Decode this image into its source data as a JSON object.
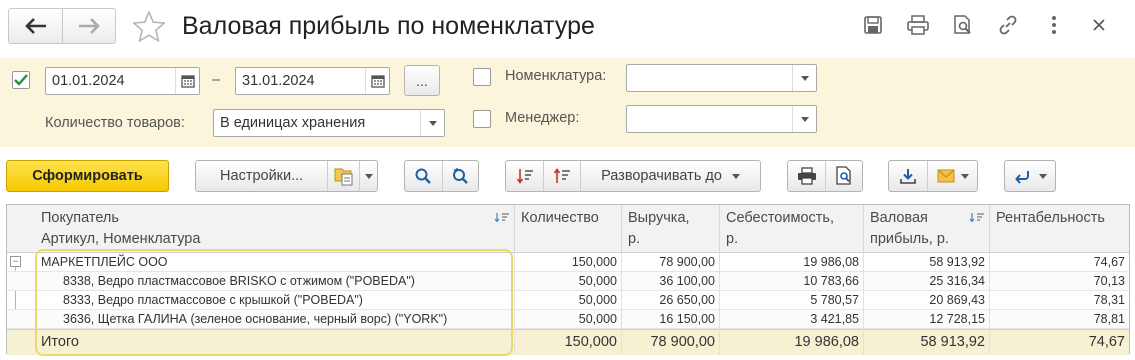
{
  "window": {
    "title": "Валовая прибыль по номенклатуре"
  },
  "params": {
    "period_enabled": true,
    "date_from": "01.01.2024",
    "date_separator": "–",
    "date_to": "31.01.2024",
    "period_button": "...",
    "quantity_label": "Количество товаров:",
    "quantity_value": "В единицах хранения",
    "nomenclature_label": "Номенклатура:",
    "nomenclature_value": "",
    "manager_label": "Менеджер:",
    "manager_value": ""
  },
  "toolbar": {
    "generate": "Сформировать",
    "settings": "Настройки...",
    "expand_to": "Разворачивать до"
  },
  "table": {
    "headers": {
      "buyer": "Покупатель",
      "article": "Артикул, Номенклатура",
      "quantity": "Количество",
      "revenue_1": "Выручка,",
      "revenue_2": "р.",
      "cost_1": "Себестоимость,",
      "cost_2": "р.",
      "profit_1": "Валовая",
      "profit_2": "прибыль, р.",
      "profitability": "Рентабельность"
    },
    "rows": [
      {
        "name": "МАРКЕТПЛЕЙС ООО",
        "quantity": "150,000",
        "revenue": "78 900,00",
        "cost": "19 986,08",
        "profit": "58 913,92",
        "profitability": "74,67"
      },
      {
        "name": "8338, Ведро пластмассовое BRISKO с отжимом (\"POBEDA\")",
        "quantity": "50,000",
        "revenue": "36 100,00",
        "cost": "10 783,66",
        "profit": "25 316,34",
        "profitability": "70,13"
      },
      {
        "name": "8333, Ведро пластмассовое с крышкой (\"POBEDA\")",
        "quantity": "50,000",
        "revenue": "26 650,00",
        "cost": "5 780,57",
        "profit": "20 869,43",
        "profitability": "78,31"
      },
      {
        "name": "3636, Щетка ГАЛИНА (зеленое основание, черный ворс) (\"YORK\")",
        "quantity": "50,000",
        "revenue": "16 150,00",
        "cost": "3 421,85",
        "profit": "12 728,15",
        "profitability": "78,81"
      }
    ],
    "total": {
      "label": "Итого",
      "quantity": "150,000",
      "revenue": "78 900,00",
      "cost": "19 986,08",
      "profit": "58 913,92",
      "profitability": "74,67"
    },
    "group_toggle": "⊟"
  }
}
